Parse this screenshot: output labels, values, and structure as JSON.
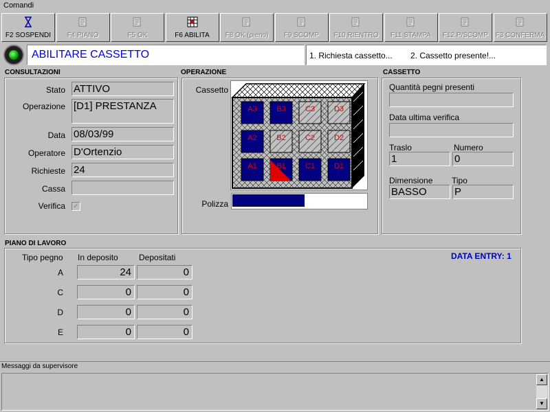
{
  "menu": {
    "comandi": "Comandi"
  },
  "toolbar": {
    "buttons": [
      {
        "label": "F2 SOSPENDI",
        "icon": "hourglass-icon",
        "enabled": true
      },
      {
        "label": "F4 PIANO",
        "icon": "document-icon",
        "enabled": false
      },
      {
        "label": "F5 OK",
        "icon": "hand-ok-icon",
        "enabled": false
      },
      {
        "label": "F6 ABILITA",
        "icon": "grid-enable-icon",
        "enabled": true
      },
      {
        "label": "F8 OK (pieno)",
        "icon": "hand-ok-full-icon",
        "enabled": false
      },
      {
        "label": "F9 SCOMP",
        "icon": "scomp-icon",
        "enabled": false
      },
      {
        "label": "F10 RIENTRO",
        "icon": "return-icon",
        "enabled": false
      },
      {
        "label": "F11 STAMPA",
        "icon": "printer-icon",
        "enabled": false
      },
      {
        "label": "F12 P/SCOMP",
        "icon": "p-scomp-icon",
        "enabled": false
      },
      {
        "label": "F3 CONFERMA",
        "icon": "confirm-icon",
        "enabled": false
      }
    ]
  },
  "header": {
    "title": "ABILITARE CASSETTO",
    "step1": "1. Richiesta cassetto...",
    "step2": "2. Cassetto presente!...",
    "title_color": "#0000e0"
  },
  "consultazioni": {
    "section": "CONSULTAZIONI",
    "stato_label": "Stato",
    "stato": "ATTIVO",
    "operazione_label": "Operazione",
    "operazione": "[D1] PRESTANZA",
    "data_label": "Data",
    "data": "08/03/99",
    "operatore_label": "Operatore",
    "operatore": "D'Ortenzio",
    "richieste_label": "Richieste",
    "richieste": "24",
    "cassa_label": "Cassa",
    "cassa": "",
    "verifica_label": "Verifica",
    "verifica_checked": true
  },
  "operazione": {
    "section": "OPERAZIONE",
    "cassetto_label": "Cassetto",
    "polizza_label": "Polizza",
    "polizza_progress": 0.7,
    "cells": [
      {
        "id": "A3",
        "style": "filled"
      },
      {
        "id": "B3",
        "style": "filled"
      },
      {
        "id": "C3",
        "style": "hatched"
      },
      {
        "id": "D3",
        "style": "hatched"
      },
      {
        "id": "A2",
        "style": "filled"
      },
      {
        "id": "B2",
        "style": "hatched"
      },
      {
        "id": "C2",
        "style": "hatched"
      },
      {
        "id": "D2",
        "style": "hatched"
      },
      {
        "id": "A1",
        "style": "filled"
      },
      {
        "id": "B1",
        "style": "selected"
      },
      {
        "id": "C1",
        "style": "filled"
      },
      {
        "id": "D1",
        "style": "filled"
      }
    ]
  },
  "cassetto": {
    "section": "CASSETTO",
    "quantita_label": "Quantità pegni presenti",
    "quantita": "",
    "data_verifica_label": "Data ultima verifica",
    "data_verifica": "",
    "traslo_label": "Traslo",
    "traslo": "1",
    "numero_label": "Numero",
    "numero": "0",
    "dimensione_label": "Dimensione",
    "dimensione": "BASSO",
    "tipo_label": "Tipo",
    "tipo": "P"
  },
  "piano": {
    "section": "PIANO DI LAVORO",
    "data_entry": "DATA ENTRY: 1",
    "col_tipo": "Tipo pegno",
    "col_deposito": "In deposito",
    "col_depositati": "Depositati",
    "rows": [
      {
        "tipo": "A",
        "deposito": "24",
        "depositati": "0"
      },
      {
        "tipo": "C",
        "deposito": "0",
        "depositati": "0"
      },
      {
        "tipo": "D",
        "deposito": "0",
        "depositati": "0"
      },
      {
        "tipo": "E",
        "deposito": "0",
        "depositati": "0"
      }
    ]
  },
  "messages": {
    "label": "Messaggi da supervisore",
    "text": ""
  }
}
